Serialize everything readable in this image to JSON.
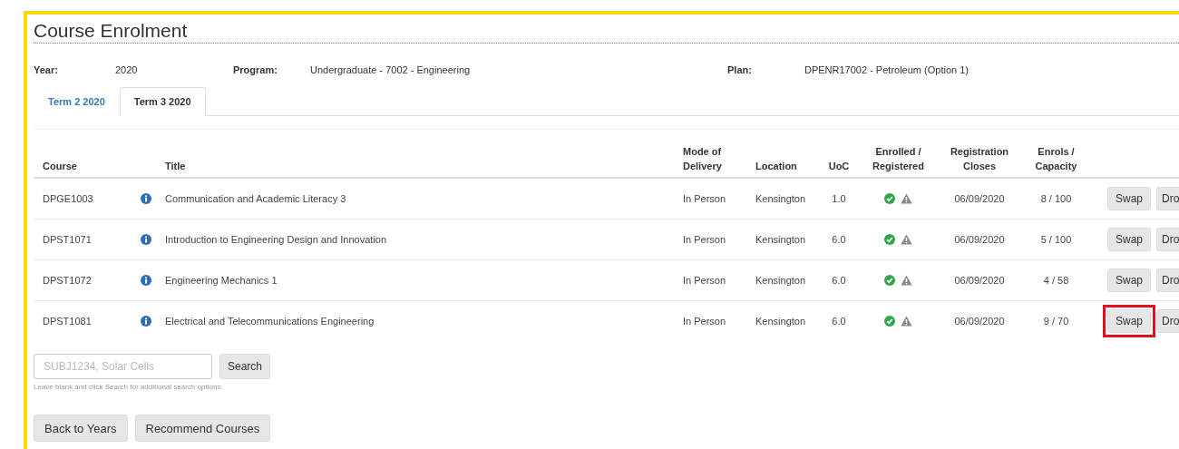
{
  "title": "Course Enrolment",
  "info": [
    {
      "label": "Year:",
      "value": "2020"
    },
    {
      "label": "Program:",
      "value": "Undergraduate - 7002 - Engineering"
    },
    {
      "label": "Plan:",
      "value": "DPENR17002 - Petroleum (Option 1)"
    }
  ],
  "tabs": [
    {
      "label": "Term 2 2020",
      "selected": false
    },
    {
      "label": "Term 3 2020",
      "selected": true
    }
  ],
  "table": {
    "columns": [
      "Course",
      "",
      "Title",
      "Mode of Delivery",
      "Location",
      "UoC",
      "Enrolled / Registered",
      "Registration Closes",
      "Enrols / Capacity"
    ],
    "rows": [
      {
        "course": "DPGE1003",
        "title": "Communication and Academic Literacy 3",
        "mode": "In Person",
        "location": "Kensington",
        "uoc": "1.0",
        "enrolled": true,
        "registered_warning": true,
        "closes": "06/09/2020",
        "capacity": "8 / 100",
        "actions": [
          "Swap",
          "Dro"
        ],
        "highlighted": false
      },
      {
        "course": "DPST1071",
        "title": "Introduction to Engineering Design and Innovation",
        "mode": "In Person",
        "location": "Kensington",
        "uoc": "6.0",
        "enrolled": true,
        "registered_warning": true,
        "closes": "06/09/2020",
        "capacity": "5 / 100",
        "actions": [
          "Swap",
          "Dro"
        ],
        "highlighted": false
      },
      {
        "course": "DPST1072",
        "title": "Engineering Mechanics 1",
        "mode": "In Person",
        "location": "Kensington",
        "uoc": "6.0",
        "enrolled": true,
        "registered_warning": true,
        "closes": "06/09/2020",
        "capacity": "4 / 58",
        "actions": [
          "Swap",
          "Dro"
        ],
        "highlighted": false
      },
      {
        "course": "DPST1081",
        "title": "Electrical and Telecommunications Engineering",
        "mode": "In Person",
        "location": "Kensington",
        "uoc": "6.0",
        "enrolled": true,
        "registered_warning": true,
        "closes": "06/09/2020",
        "capacity": "9 / 70",
        "actions": [
          "Swap",
          "Dro"
        ],
        "highlighted": true
      }
    ]
  },
  "search": {
    "placeholder": "SUBJ1234, Solar Cells",
    "button": "Search",
    "hint": "Leave blank and click Search for additional search options."
  },
  "buttons": [
    "Back to Years",
    "Recommend Courses"
  ]
}
